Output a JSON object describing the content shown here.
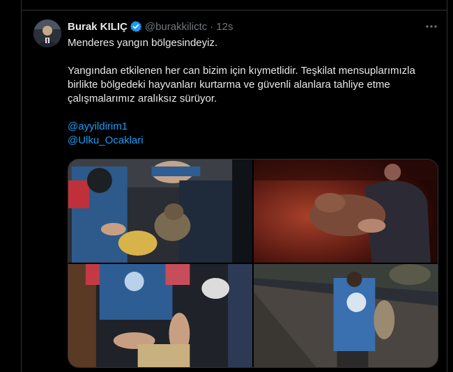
{
  "tweet": {
    "author_name": "Burak KILIÇ",
    "handle": "@burakkilictc",
    "separator": "·",
    "time": "12s",
    "verified": true,
    "paragraphs": [
      "Menderes yangın bölgesindeyiz.",
      "Yangından etkilenen her can bizim için kıymetlidir. Teşkilat mensuplarımızla birlikte bölgedeki hayvanları kurtarma ve güvenli alanlara tahliye etme çalışmalarımız aralıksız sürüyor."
    ],
    "mentions": [
      "@ayyildirim1",
      "@Ulku_Ocaklari"
    ],
    "media": [
      {
        "icon": "photo-cat-rescue-icon"
      },
      {
        "icon": "photo-night-carry-animal-icon"
      },
      {
        "icon": "photo-feeding-cat-icon"
      },
      {
        "icon": "photo-volunteer-walking-icon"
      }
    ]
  },
  "colors": {
    "background": "#000000",
    "text": "#e7e9ea",
    "muted": "#71767b",
    "link": "#1d9bf0",
    "border": "#2f3336",
    "verified": "#1d9bf0"
  }
}
